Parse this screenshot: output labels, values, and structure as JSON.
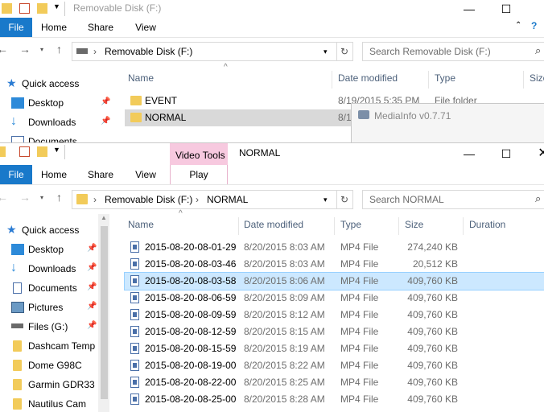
{
  "back_window": {
    "title": "Removable Disk (F:)",
    "tabs": [
      "File",
      "Home",
      "Share",
      "View"
    ],
    "address": "Removable Disk (F:)",
    "search_placeholder": "Search Removable Disk (F:)",
    "quick_access": "Quick access",
    "nav_items": [
      {
        "label": "Desktop",
        "icon": "desktop-icon"
      },
      {
        "label": "Downloads",
        "icon": "download-icon"
      },
      {
        "label": "Documents",
        "icon": "documents-icon"
      }
    ],
    "columns": [
      "Name",
      "Date modified",
      "Type",
      "Size"
    ],
    "rows": [
      {
        "name": "EVENT",
        "date": "8/19/2015 5:35 PM",
        "type": "File folder"
      },
      {
        "name": "NORMAL",
        "date": "8/1"
      }
    ]
  },
  "mediainfo": {
    "title": "MediaInfo v0.7.71"
  },
  "front_window": {
    "title": "NORMAL",
    "context_tab": "Video Tools",
    "tabs": [
      "File",
      "Home",
      "Share",
      "View",
      "Play"
    ],
    "breadcrumb": [
      "Removable Disk (F:)",
      "NORMAL"
    ],
    "search_placeholder": "Search NORMAL",
    "quick_access": "Quick access",
    "nav_items": [
      {
        "label": "Desktop",
        "icon": "desktop-icon",
        "pinned": true
      },
      {
        "label": "Downloads",
        "icon": "download-icon",
        "pinned": true
      },
      {
        "label": "Documents",
        "icon": "documents-icon",
        "pinned": true
      },
      {
        "label": "Pictures",
        "icon": "pictures-icon",
        "pinned": true
      },
      {
        "label": "Files (G:)",
        "icon": "drive-icon",
        "pinned": true
      },
      {
        "label": "Dashcam Temp",
        "icon": "folder-icon",
        "pinned": false
      },
      {
        "label": "Dome G98C",
        "icon": "folder-icon",
        "pinned": false
      },
      {
        "label": "Garmin GDR33",
        "icon": "folder-icon",
        "pinned": false
      },
      {
        "label": "Nautilus Cam",
        "icon": "folder-icon",
        "pinned": false
      }
    ],
    "columns": [
      "Name",
      "Date modified",
      "Type",
      "Size",
      "Duration"
    ],
    "files": [
      {
        "name": "2015-08-20-08-01-29",
        "date": "8/20/2015 8:03 AM",
        "type": "MP4 File",
        "size": "274,240 KB"
      },
      {
        "name": "2015-08-20-08-03-46",
        "date": "8/20/2015 8:03 AM",
        "type": "MP4 File",
        "size": "20,512 KB"
      },
      {
        "name": "2015-08-20-08-03-58",
        "date": "8/20/2015 8:06 AM",
        "type": "MP4 File",
        "size": "409,760 KB"
      },
      {
        "name": "2015-08-20-08-06-59",
        "date": "8/20/2015 8:09 AM",
        "type": "MP4 File",
        "size": "409,760 KB"
      },
      {
        "name": "2015-08-20-08-09-59",
        "date": "8/20/2015 8:12 AM",
        "type": "MP4 File",
        "size": "409,760 KB"
      },
      {
        "name": "2015-08-20-08-12-59",
        "date": "8/20/2015 8:15 AM",
        "type": "MP4 File",
        "size": "409,760 KB"
      },
      {
        "name": "2015-08-20-08-15-59",
        "date": "8/20/2015 8:19 AM",
        "type": "MP4 File",
        "size": "409,760 KB"
      },
      {
        "name": "2015-08-20-08-19-00",
        "date": "8/20/2015 8:22 AM",
        "type": "MP4 File",
        "size": "409,760 KB"
      },
      {
        "name": "2015-08-20-08-22-00",
        "date": "8/20/2015 8:25 AM",
        "type": "MP4 File",
        "size": "409,760 KB"
      },
      {
        "name": "2015-08-20-08-25-00",
        "date": "8/20/2015 8:28 AM",
        "type": "MP4 File",
        "size": "409,760 KB"
      }
    ]
  },
  "colors": {
    "file_tab": "#1979ca",
    "video_tools": "#f6c3dc",
    "selected_row": "#cce8ff",
    "selected_border": "#99d1ff"
  }
}
